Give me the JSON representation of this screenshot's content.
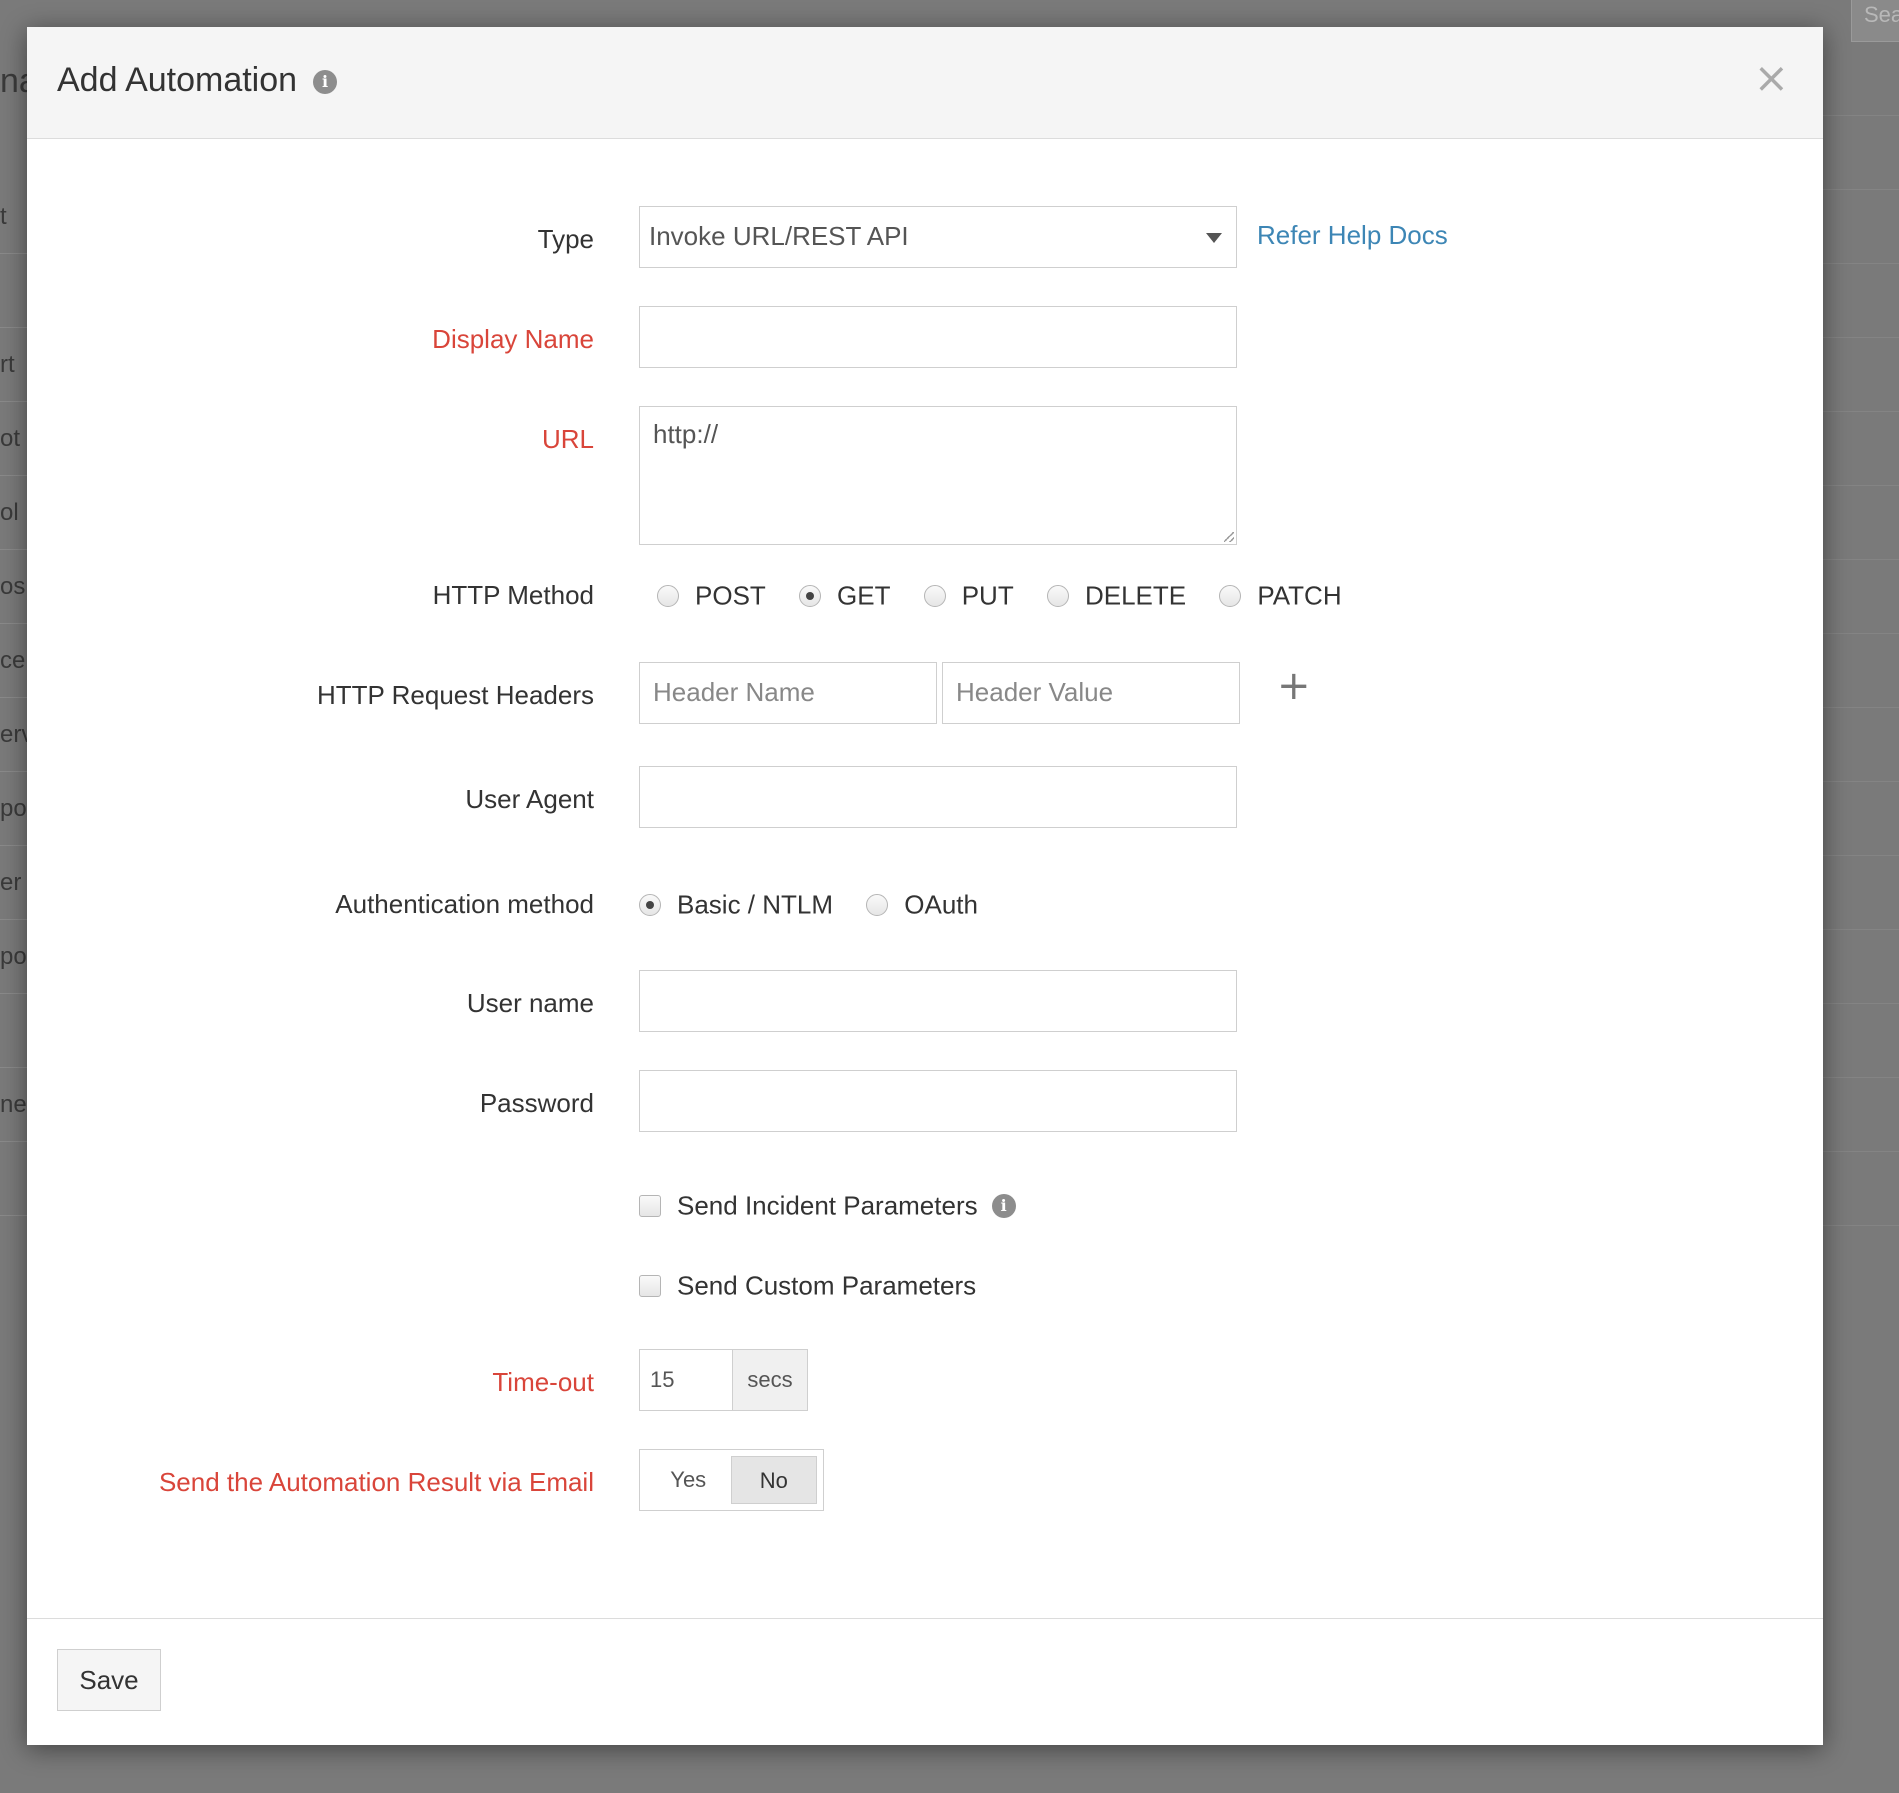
{
  "background": {
    "search_placeholder": "Sea",
    "title_fragment": "na",
    "list_fragments": [
      "t",
      "",
      "rt",
      "ot",
      "ol",
      "os",
      "ce",
      "erv",
      "po",
      "er",
      "po",
      "",
      "ne",
      ""
    ]
  },
  "modal": {
    "title": "Add Automation",
    "info_glyph": "i",
    "close_glyph": "×"
  },
  "form": {
    "type": {
      "label": "Type",
      "value": "Invoke URL/REST API",
      "help_link": "Refer Help Docs"
    },
    "display_name": {
      "label": "Display Name",
      "value": ""
    },
    "url": {
      "label": "URL",
      "value": "http://"
    },
    "http_method": {
      "label": "HTTP Method",
      "options": [
        "POST",
        "GET",
        "PUT",
        "DELETE",
        "PATCH"
      ],
      "selected": "GET"
    },
    "headers": {
      "label": "HTTP Request Headers",
      "name_placeholder": "Header Name",
      "value_placeholder": "Header Value",
      "add_glyph": "+"
    },
    "user_agent": {
      "label": "User Agent",
      "value": ""
    },
    "auth_method": {
      "label": "Authentication method",
      "options": [
        "Basic / NTLM",
        "OAuth"
      ],
      "selected": "Basic / NTLM"
    },
    "username": {
      "label": "User name",
      "value": ""
    },
    "password": {
      "label": "Password",
      "value": ""
    },
    "send_incident_params": {
      "label": "Send Incident Parameters",
      "checked": false
    },
    "send_custom_params": {
      "label": "Send Custom Parameters",
      "checked": false
    },
    "timeout": {
      "label": "Time-out",
      "value": "15",
      "unit": "secs"
    },
    "email_result": {
      "label": "Send the Automation Result via Email",
      "yes": "Yes",
      "no": "No",
      "selected": "No"
    }
  },
  "footer": {
    "save_label": "Save"
  },
  "colors": {
    "required": "#d9453a",
    "link": "#3d86b5",
    "overlay": "#7a7a7a"
  }
}
